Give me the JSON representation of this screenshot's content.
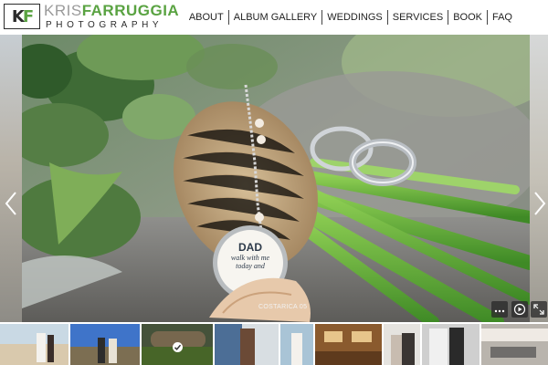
{
  "brand": {
    "mark_k": "K",
    "mark_f": "F",
    "name_first": "KRIS",
    "name_last": "FARRUGGIA",
    "tagline": "PHOTOGRAPHY",
    "accent_color": "#5aa342"
  },
  "nav": {
    "items": [
      "ABOUT",
      "ALBUM GALLERY",
      "WEDDINGS",
      "SERVICES",
      "BOOK",
      "FAQ"
    ]
  },
  "slide": {
    "charm_text": [
      "DAD",
      "walk with me",
      "today and"
    ],
    "caption": "COSTARICA 05"
  },
  "controls": {
    "prev_icon": "chevron-left-icon",
    "next_icon": "chevron-right-icon",
    "info_icon": "ellipsis-icon",
    "play_icon": "play-icon",
    "fullscreen_icon": "fullscreen-icon"
  },
  "thumbnails": {
    "count_visible": 9,
    "selected_index": 2,
    "selected_icon": "checkmark-icon"
  }
}
